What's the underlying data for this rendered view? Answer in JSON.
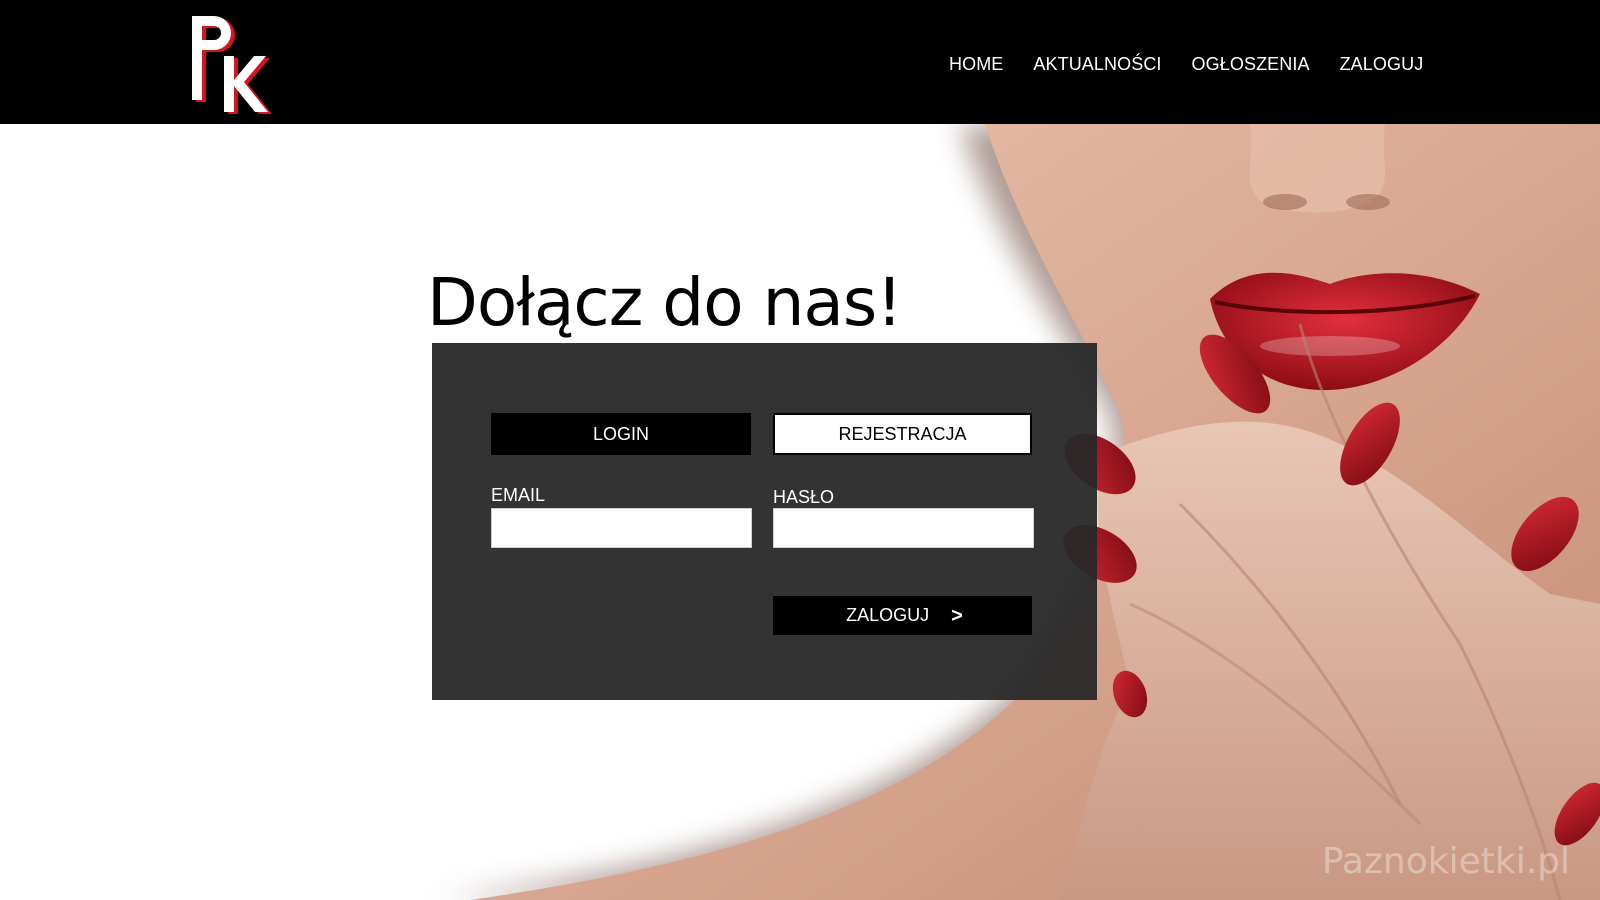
{
  "header": {
    "logo_alt": "PK",
    "nav": [
      {
        "label": "HOME"
      },
      {
        "label": "AKTUALNOŚCI"
      },
      {
        "label": "OGŁOSZENIA"
      },
      {
        "label": "ZALOGUJ"
      }
    ]
  },
  "main": {
    "heading": "Dołącz do nas!",
    "tabs": {
      "login": "LOGIN",
      "register": "REJESTRACJA"
    },
    "form": {
      "email_label": "EMAIL",
      "email_value": "",
      "password_label": "HASŁO",
      "password_value": "",
      "submit_label": "ZALOGUJ",
      "submit_icon": "arrow-right-icon"
    }
  },
  "watermark": "Paznokietki.pl",
  "colors": {
    "header_bg": "#000000",
    "panel_bg": "#282828",
    "accent_red": "#c8102e",
    "lip_red": "#b3121f"
  }
}
